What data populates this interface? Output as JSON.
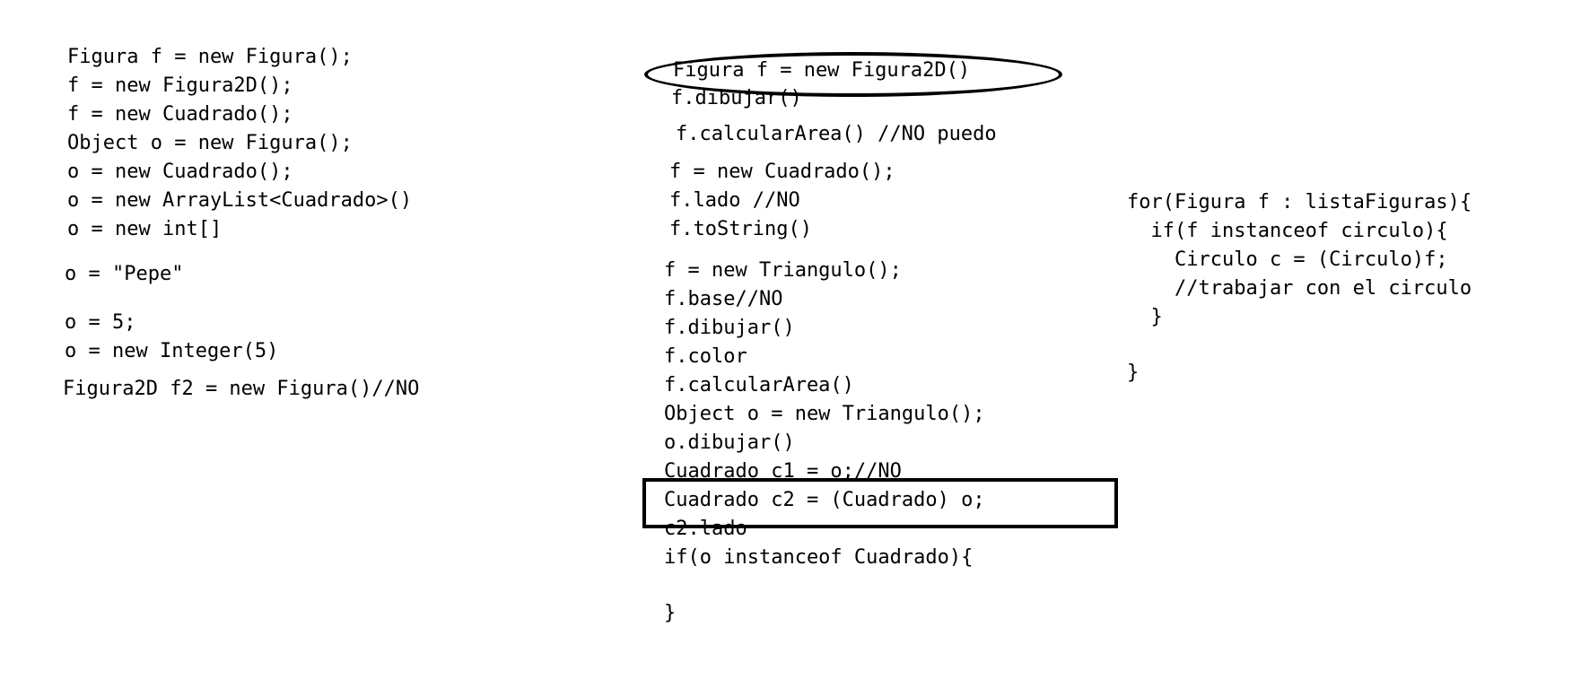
{
  "columns": {
    "left": {
      "lines": [
        "Figura f = new Figura();",
        "f = new Figura2D();",
        "f = new Cuadrado();",
        "Object o = new Figura();",
        "o = new Cuadrado();",
        "o = new ArrayList<Cuadrado>()",
        "o = new int[]",
        "o = \"Pepe\"",
        "o = 5;",
        "o = new Integer(5)",
        "Figura2D f2 = new Figura()//NO"
      ]
    },
    "middle": {
      "lines": [
        "Figura f = new Figura2D()",
        "f.dibujar()",
        "f.calcularArea() //NO puedo",
        "f = new Cuadrado();",
        "f.lado //NO",
        "f.toString()",
        "f = new Triangulo();",
        "f.base//NO",
        "f.dibujar()",
        "f.color",
        "f.calcularArea()",
        "Object o = new Triangulo();",
        "o.dibujar()",
        "Cuadrado c1 = o;//NO",
        "Cuadrado c2 = (Cuadrado) o;",
        "c2.lado",
        "if(o instanceof Cuadrado){",
        "}"
      ]
    },
    "right": {
      "lines": [
        "for(Figura f : listaFiguras){",
        "  if(f instanceof circulo){",
        "    Circulo c = (Circulo)f;",
        "    //trabajar con el circulo",
        "  }",
        "}"
      ]
    }
  },
  "annotations": {
    "ellipse_color": "#000000",
    "rect_color": "#000000"
  }
}
